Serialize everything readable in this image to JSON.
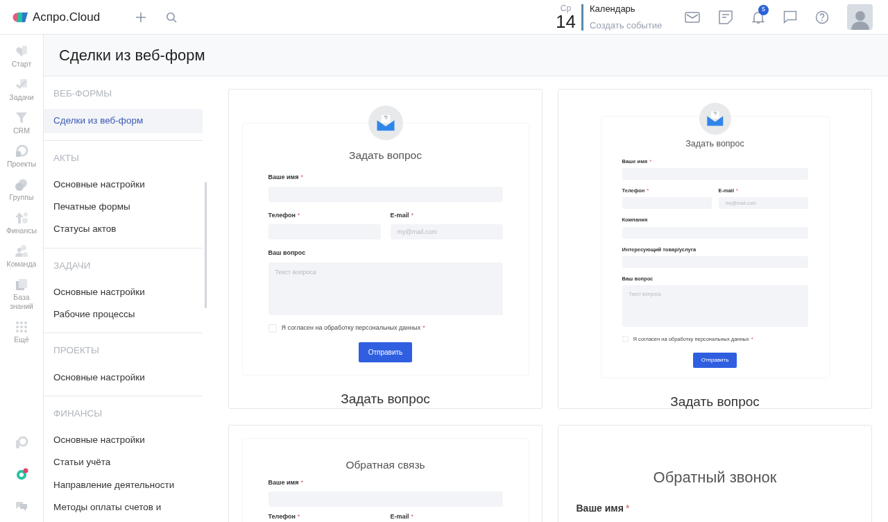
{
  "header": {
    "logo": "Аспро.Cloud",
    "date": {
      "weekday": "Ср",
      "day": "14"
    },
    "calendar": {
      "title": "Календарь",
      "action": "Создать событие"
    },
    "notifications_badge": "5"
  },
  "rail": {
    "items": [
      {
        "label": "Старт",
        "kind": "heart"
      },
      {
        "label": "Задачи",
        "kind": "check"
      },
      {
        "label": "CRM",
        "kind": "funnel"
      },
      {
        "label": "Проекты",
        "kind": "target"
      },
      {
        "label": "Группы",
        "kind": "circles"
      },
      {
        "label": "Финансы",
        "kind": "arrow"
      },
      {
        "label": "Команда",
        "kind": "people"
      },
      {
        "label": "База знаний",
        "kind": "book"
      },
      {
        "label": "Ещё",
        "kind": "dots"
      }
    ]
  },
  "page_title": "Сделки из веб-форм",
  "settings_nav": {
    "sections": [
      {
        "title": "ВЕБ-ФОРМЫ",
        "items": [
          {
            "label": "Сделки из веб-форм",
            "selected": true
          }
        ]
      },
      {
        "title": "АКТЫ",
        "items": [
          {
            "label": "Основные настройки",
            "selected": false
          },
          {
            "label": "Печатные формы",
            "selected": false
          },
          {
            "label": "Статусы актов",
            "selected": false
          }
        ]
      },
      {
        "title": "ЗАДАЧИ",
        "items": [
          {
            "label": "Основные настройки",
            "selected": false
          },
          {
            "label": "Рабочие процессы",
            "selected": false
          }
        ]
      },
      {
        "title": "ПРОЕКТЫ",
        "items": [
          {
            "label": "Основные настройки",
            "selected": false
          }
        ]
      },
      {
        "title": "ФИНАНСЫ",
        "items": [
          {
            "label": "Основные настройки",
            "selected": false
          },
          {
            "label": "Статьи учёта",
            "selected": false
          },
          {
            "label": "Направление деятельности",
            "selected": false
          },
          {
            "label": "Методы оплаты счетов и",
            "selected": false
          }
        ]
      }
    ]
  },
  "forms": [
    {
      "preview": {
        "kind": "standard",
        "icon": true,
        "title": "Задать вопрос",
        "fields": [
          {
            "label": "Ваше имя",
            "required_mark": "*",
            "kind": "text",
            "half": false
          },
          {
            "label": "Телефон",
            "required_mark": "*",
            "kind": "text",
            "half": true
          },
          {
            "label": "E-mail",
            "required_mark": "*",
            "kind": "text",
            "half": true,
            "placeholder": "my@mail.com"
          },
          {
            "label": "Ваш вопрос",
            "kind": "textarea",
            "half": false,
            "placeholder": "Текст вопроса"
          }
        ],
        "consent": {
          "label": "Я согласен на обработку персональных данных",
          "required_mark": "*",
          "checked": false
        },
        "button": "Отправить"
      },
      "caption": "Задать вопрос"
    },
    {
      "preview": {
        "kind": "compact",
        "icon": true,
        "title": "Задать вопрос",
        "fields": [
          {
            "label": "Ваше имя",
            "required_mark": "*",
            "kind": "text",
            "half": false
          },
          {
            "label": "Телефон",
            "required_mark": "*",
            "kind": "text",
            "half": true
          },
          {
            "label": "E-mail",
            "required_mark": "*",
            "kind": "text",
            "half": true,
            "placeholder": "my@mail.com"
          },
          {
            "label": "Компания",
            "kind": "text",
            "half": false
          },
          {
            "label": "Интересующий товар/услуга",
            "kind": "text",
            "half": false
          },
          {
            "label": "Ваш вопрос",
            "kind": "textarea",
            "half": false,
            "placeholder": "Текст вопроса"
          }
        ],
        "consent": {
          "label": "Я согласен на обработку персональных данных",
          "required_mark": "*",
          "checked": false
        },
        "button": "Отправить"
      },
      "caption": "Задать вопрос"
    },
    {
      "preview": {
        "kind": "standard",
        "icon": false,
        "title": "Обратная связь",
        "fields": [
          {
            "label": "Ваше имя",
            "required_mark": "*",
            "kind": "text",
            "half": false
          },
          {
            "label": "Телефон",
            "required_mark": "*",
            "kind": "text",
            "half": true
          },
          {
            "label": "E-mail",
            "required_mark": "*",
            "kind": "text",
            "half": true
          }
        ]
      }
    },
    {
      "preview": {
        "kind": "large",
        "icon": false,
        "title": "Обратный звонок",
        "fields": [
          {
            "label": "Ваше имя",
            "required_mark": "*",
            "kind": "text",
            "half": false
          }
        ]
      }
    }
  ]
}
